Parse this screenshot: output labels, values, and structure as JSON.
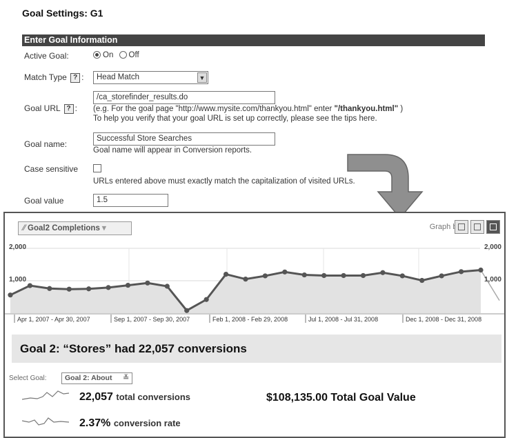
{
  "page_title": "Goal Settings: G1",
  "section_header": "Enter Goal Information",
  "form": {
    "active_goal": {
      "label": "Active Goal:",
      "on_label": "On",
      "off_label": "Off",
      "selected": "On"
    },
    "match_type": {
      "label": "Match Type",
      "help": "?",
      "suffix": ":",
      "value": "Head Match"
    },
    "goal_url": {
      "label": "Goal URL",
      "help": "?",
      "suffix": ":",
      "value": "/ca_storefinder_results.do",
      "hint_prefix": "(e.g. For the goal page \"http://www.mysite.com/thankyou.html\" enter ",
      "hint_bold": "\"/thankyou.html\"",
      "hint_suffix": " )",
      "tip": "To help you verify that your goal URL is set up correctly, please see the tips here."
    },
    "goal_name": {
      "label": "Goal name:",
      "value": "Successful Store Searches",
      "note": "Goal name will appear in Conversion reports."
    },
    "case_sensitive": {
      "label": "Case sensitive",
      "note": "URLs entered above must exactly match the capitalization of visited URLs.",
      "checked": false
    },
    "goal_value": {
      "label": "Goal value",
      "value": "1.5"
    }
  },
  "report": {
    "tab_label": "Goal2 Completions",
    "graph_by_label": "Graph by:",
    "goal_summary": "Goal 2: “Stores” had 22,057 conversions",
    "select_goal_label": "Select Goal:",
    "select_goal_value": "Goal 2: About",
    "total_conversions_value": "22,057",
    "total_conversions_label": "total conversions",
    "conversion_rate_value": "2.37%",
    "conversion_rate_label": "conversion rate",
    "total_goal_value": "$108,135.00 Total Goal Value"
  },
  "chart_data": {
    "type": "line",
    "series": [
      {
        "name": "Goal2 Completions",
        "values": [
          560,
          850,
          760,
          740,
          750,
          790,
          860,
          930,
          830,
          80,
          420,
          1200,
          1050,
          1150,
          1270,
          1180,
          1160,
          1160,
          1160,
          1250,
          1150,
          1010,
          1150,
          1280,
          1330,
          390
        ]
      }
    ],
    "y_ticks_left": [
      "2,000",
      "1,000"
    ],
    "y_ticks_right": [
      "2,000",
      "1,000"
    ],
    "ylim": [
      0,
      2000
    ],
    "x_labels": [
      "Apr 1, 2007 - Apr 30, 2007",
      "Sep 1, 2007 - Sep 30, 2007",
      "Feb 1, 2008 - Feb 29, 2008",
      "Jul 1, 2008 - Jul 31, 2008",
      "Dec 1, 2008 - Dec 31, 2008"
    ],
    "line_color": "#555555",
    "fill_color": "#e2e2e2"
  }
}
